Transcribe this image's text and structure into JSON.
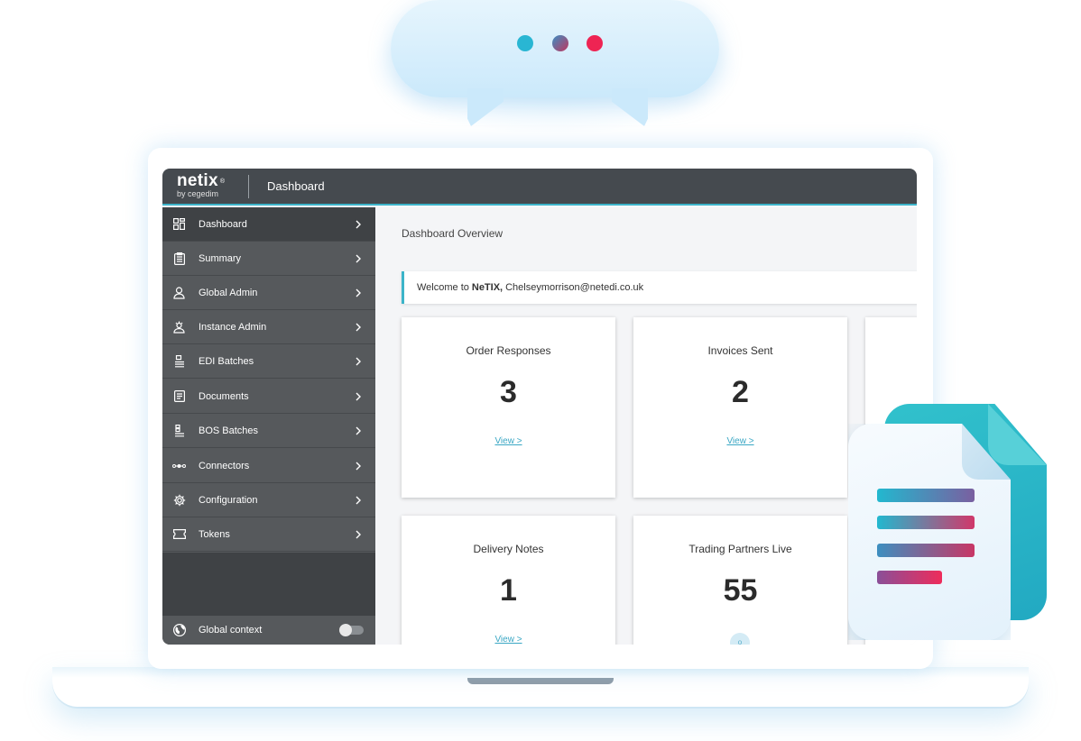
{
  "app": {
    "logo": "netix",
    "logo_mark": "®",
    "logo_sub": "by cegedim",
    "page_title": "Dashboard"
  },
  "sidebar": {
    "items": [
      {
        "label": "Dashboard",
        "icon": "dashboard-grid-icon"
      },
      {
        "label": "Summary",
        "icon": "clipboard-icon"
      },
      {
        "label": "Global Admin",
        "icon": "user-admin-icon"
      },
      {
        "label": "Instance Admin",
        "icon": "instance-admin-icon"
      },
      {
        "label": "EDI Batches",
        "icon": "batch-stack-icon"
      },
      {
        "label": "Documents",
        "icon": "document-icon"
      },
      {
        "label": "BOS Batches",
        "icon": "bos-batch-icon"
      },
      {
        "label": "Connectors",
        "icon": "connector-icon"
      },
      {
        "label": "Configuration",
        "icon": "gear-icon"
      },
      {
        "label": "Tokens",
        "icon": "ticket-icon"
      }
    ],
    "global_context_label": "Global context",
    "global_context_enabled": false
  },
  "main": {
    "section_title": "Dashboard Overview",
    "welcome_prefix": "Welcome to",
    "welcome_brand": "NeTIX,",
    "welcome_email": "Chelseymorrison@netedi.co.uk",
    "cards": [
      {
        "title": "Order Responses",
        "value": "3",
        "link": "View >"
      },
      {
        "title": "Invoices Sent",
        "value": "2",
        "link": "View >"
      },
      {
        "title": "Delivery Notes",
        "value": "1",
        "link": "View >"
      },
      {
        "title": "Trading Partners Live",
        "value": "55",
        "badge": "o"
      }
    ]
  },
  "colors": {
    "accent": "#3cb4c9",
    "topbar": "#454a4f",
    "sidebar": "#56595c",
    "dot_cyan": "#29b6d3",
    "dot_red": "#ee2453"
  }
}
